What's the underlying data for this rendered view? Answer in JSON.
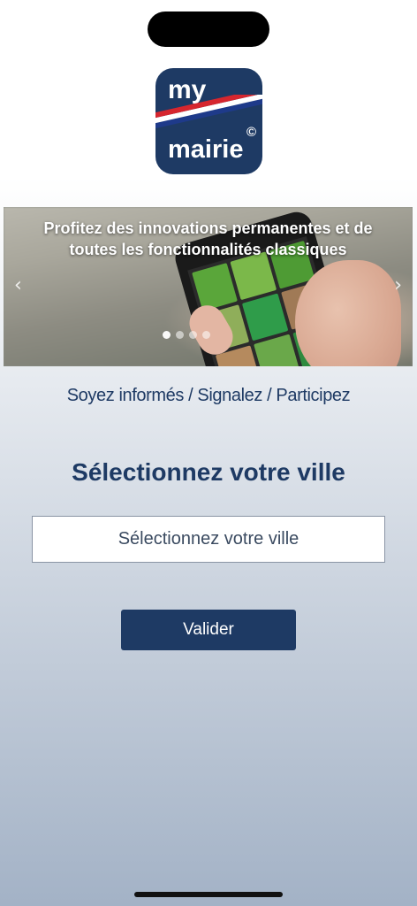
{
  "logo": {
    "line1": "my",
    "line2": "mairie",
    "copyright": "©"
  },
  "carousel": {
    "caption": "Profitez des innovations permanentes et de toutes les fonctionnalités classiques",
    "prev_icon": "chevron-left-icon",
    "next_icon": "chevron-right-icon",
    "prev_glyph": "‹",
    "next_glyph": "›",
    "active_slide": 1,
    "slide_count": 4
  },
  "tagline": "Soyez informés / Signalez / Participez",
  "title": "Sélectionnez votre ville",
  "city_select": {
    "placeholder": "Sélectionnez votre ville"
  },
  "submit_label": "Valider",
  "colors": {
    "brand_navy": "#1e3a64",
    "flag_blue": "#1e3a8a",
    "flag_white": "#ffffff",
    "flag_red": "#d6262e"
  }
}
